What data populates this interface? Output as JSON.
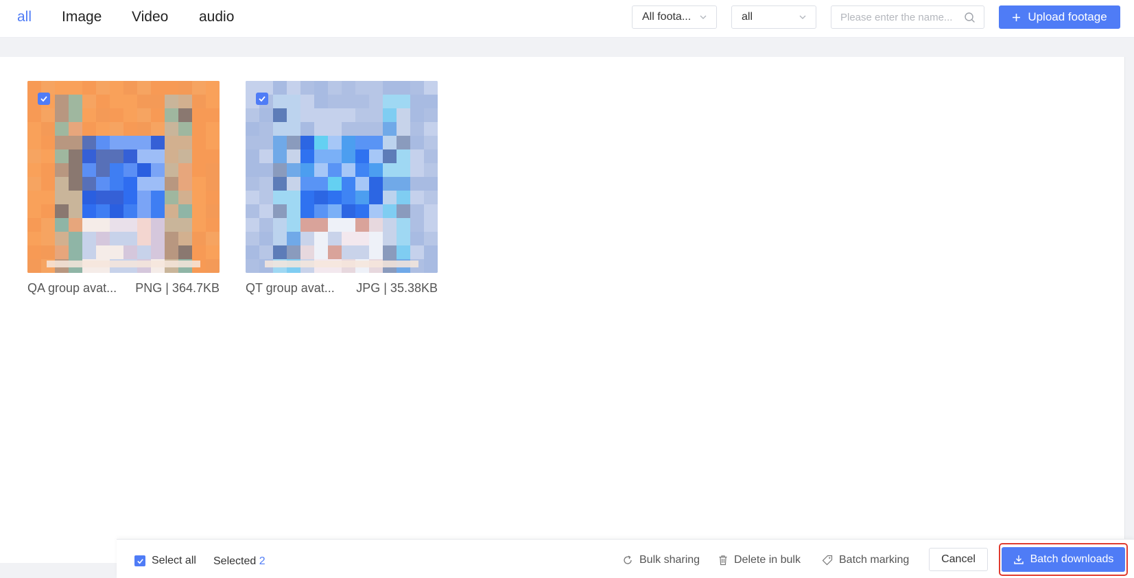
{
  "header": {
    "tabs": [
      {
        "label": "all",
        "active": true
      },
      {
        "label": "Image",
        "active": false
      },
      {
        "label": "Video",
        "active": false
      },
      {
        "label": "audio",
        "active": false
      }
    ],
    "footage_filter": {
      "value": "All foota..."
    },
    "scope_filter": {
      "value": "all"
    },
    "search": {
      "placeholder": "Please enter the name...",
      "value": ""
    },
    "upload_label": "Upload footage"
  },
  "assets": [
    {
      "name": "QA group avat...",
      "info": "PNG | 364.7KB",
      "selected": true,
      "theme": "orange"
    },
    {
      "name": "QT group avat...",
      "info": "JPG | 35.38KB",
      "selected": true,
      "theme": "blue"
    }
  ],
  "bottom_bar": {
    "select_all_label": "Select all",
    "selected_label": "Selected",
    "selected_count": "2",
    "actions": {
      "share": "Bulk sharing",
      "delete": "Delete in bulk",
      "mark": "Batch marking"
    },
    "cancel_label": "Cancel",
    "batch_download_label": "Batch downloads"
  },
  "colors": {
    "accent": "#4f7cf6",
    "highlight_border": "#e03b2f"
  }
}
